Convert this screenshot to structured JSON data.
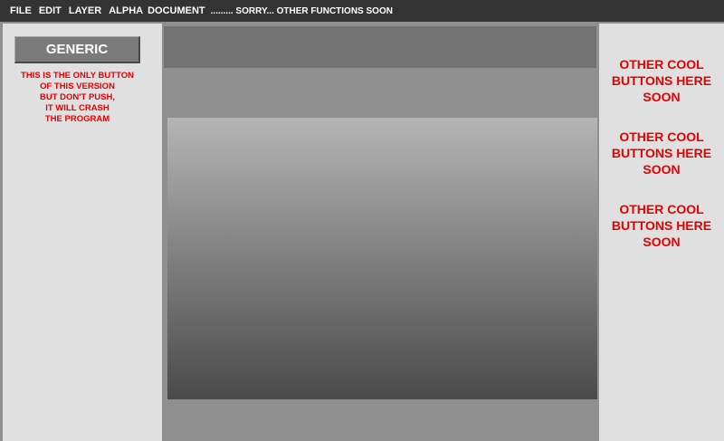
{
  "menubar": {
    "items": [
      "FILE",
      "EDIT",
      "LAYER",
      "ALPHA",
      "DOCUMENT"
    ],
    "note": "......... SORRY... OTHER FUNCTIONS SOON"
  },
  "left_panel": {
    "button_label": "GENERIC",
    "warning_lines": [
      "THIS IS THE ONLY BUTTON",
      "OF THIS VERSION",
      "BUT DON'T PUSH,",
      "IT WILL CRASH",
      "THE PROGRAM"
    ]
  },
  "right_panel": {
    "placeholders": [
      [
        "OTHER COOL",
        "BUTTONS HERE",
        "SOON"
      ],
      [
        "OTHER COOL",
        "BUTTONS HERE",
        "SOON"
      ],
      [
        "OTHER COOL",
        "BUTTONS HERE",
        "SOON"
      ]
    ]
  },
  "colors": {
    "menubar_bg": "#333333",
    "accent_text": "#e60000",
    "panel_bg": "#e0e0e0",
    "workspace_bg": "#8f8f8f"
  }
}
